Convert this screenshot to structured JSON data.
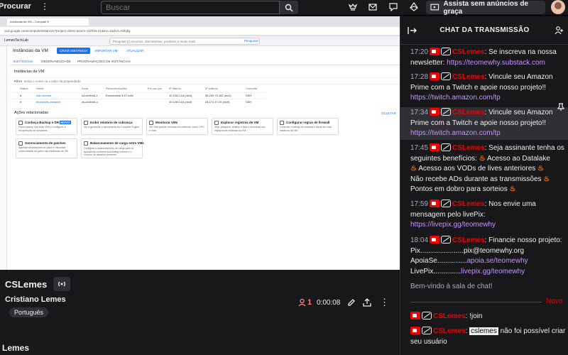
{
  "nav": {
    "brand": "Procurar",
    "search_placeholder": "Buscar",
    "ad_free_label": "Assista sem anúncios de graça"
  },
  "gcp": {
    "tab_title": "Instâncias de VM – Compute E",
    "url": "oud.google.com/compute/instances?project=direct-axiom-437915-e1&inv=1&invt=Abfqkg",
    "project": "LemesTechLab",
    "search_placeholder": "Pesquise (/) recursos, documentos, produtos e muito mais",
    "search_button": "Pesquisar",
    "page_title": "Instâncias da VM",
    "create_button": "CRIAR INSTÂNCIA",
    "import_button": "IMPORTAR VM",
    "refresh_button": "ATUALIZAR",
    "tabs": [
      "INSTÂNCIAS",
      "OBSERVABILIDADE",
      "PROGRAMAÇÕES DE INSTÂNCIAS"
    ],
    "subtitle": "Instâncias da VM",
    "filter_label": "Filtro",
    "filter_placeholder": "Insira o nome ou o valor da propriedade",
    "columns": [
      "Status",
      "Nome",
      "Zona",
      "Recomendações",
      "Em uso por",
      "IP interno",
      "IP externo",
      "Conectar"
    ],
    "rows": [
      {
        "name": "ssh-runners",
        "zone": "us-central1-f",
        "recommendation": "Economizar $ 6 / mês",
        "internal_ip": "10.128.0.18 (nic0)",
        "external_ip": "35.209.70.182 (nic0)",
        "connect": "SSH"
      },
      {
        "name": "teomewhy-instance",
        "zone": "us-central1-c",
        "recommendation": "",
        "internal_ip": "10.128.0.16 (nic0)",
        "external_ip": "34.172.47.23 (nic0)",
        "connect": "SSH"
      }
    ],
    "related_title": "Ações relacionadas",
    "hide_label": "OCULTAR",
    "cards": [
      {
        "title": "Conheça Backup e DR",
        "badge": "NOVO",
        "desc": "Fazer backup das suas VMs e configurar a recuperação de desastres"
      },
      {
        "title": "Exibir relatório de cobrança",
        "desc": "Ver e gerenciar o faturamento do Compute Engine"
      },
      {
        "title": "Monitorar VMs",
        "desc": "Ver VMs padrão remotas em métricas, como CPU e rede"
      },
      {
        "title": "Explorar registros de VM",
        "desc": "Veja, pesquise, analise e faça o download dos registros de instância da VM"
      },
      {
        "title": "Configurar regras de firewall",
        "desc": "Controlar o tráfego de entrada e saída em uma instância da VM"
      },
      {
        "title": "Gerenciamento de patches",
        "desc": "Agendar atualizações de patch e visualizar conformidade de patch nas instâncias de VM"
      },
      {
        "title": "Balanceamento de carga entre VMs",
        "desc": "Configure o balanceamento de carga para os aplicativos conforme sua tráfego cresce e o número de usuários aumenta"
      }
    ]
  },
  "channel": {
    "name": "CSLemes",
    "streamer": "Cristiano Lemes",
    "language": "Português",
    "viewers": "1",
    "uptime": "0:00:08",
    "bottom_title": "Lemes"
  },
  "chat": {
    "title": "CHAT DA TRANSMISSÃO",
    "messages": [
      {
        "time": "17:20",
        "user": "CSLemes",
        "text": ": Se inscreva na nossa newsletter: ",
        "link": "https://teomewhy.substack.com"
      },
      {
        "time": "17:28",
        "user": "CSLemes",
        "text": ": Vincule seu Amazon Prime com a Twitch e apoie nosso projeto!! ",
        "link": "https://twitch.amazon.com/tp"
      },
      {
        "time": "17:34",
        "user": "CSLemes",
        "text": ": Vincule seu Amazon Prime com a Twitch e apoie nosso projeto!! ",
        "link": "https://twitch.amazon.com/tp"
      },
      {
        "time": "17:45",
        "user": "CSLemes",
        "text": ": Seja assinante tenha os seguintes benefícios:",
        "bullets": [
          "Acesso ao Datalake",
          "Acesso aos VODs de lives anteriores",
          "Não recebe ADs durante as transmissões",
          "Pontos em dobro para sorteios"
        ]
      },
      {
        "time": "17:59",
        "user": "CSLemes",
        "text": ": Nos envie uma mensagem pelo livePix: ",
        "link": "https://livepix.gg/teomewhy"
      },
      {
        "time": "18:04",
        "user": "CSLemes",
        "text": ": Financie nosso projeto:",
        "lines": [
          "Pix......................pix@teomewhy.org",
          "ApoiaSe...............",
          "LivePix.............."
        ],
        "links": [
          "apoia.se/teomewhy",
          "livepix.gg/teomewhy"
        ]
      }
    ],
    "welcome": "Bem-vindo à sala de chat!",
    "new_label": "Novo",
    "recent": [
      {
        "user": "CSLemes",
        "text": ": !join"
      },
      {
        "user": "CSLemes",
        "mention": "cslemes",
        "text": " não foi possível criar seu usuário"
      }
    ]
  }
}
